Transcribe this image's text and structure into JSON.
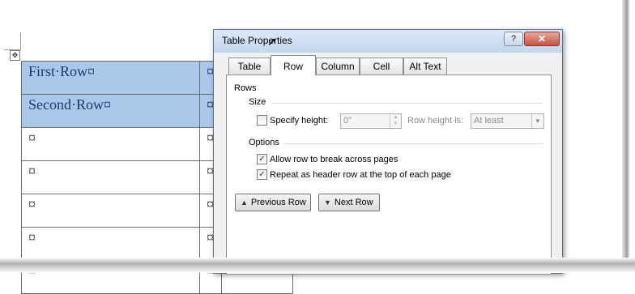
{
  "document": {
    "header_rows": [
      {
        "label": "First·Row¤",
        "end_mark": "¤",
        "last_mark": "¤"
      },
      {
        "label": "Second·Row¤",
        "end_mark": "¤",
        "last_mark": "¤"
      }
    ],
    "body_rows": [
      {
        "c1": "¤",
        "c2": "¤",
        "c3": "¤"
      },
      {
        "c1": "¤",
        "c2": "¤",
        "c3": "¤"
      },
      {
        "c1": "¤",
        "c2": "¤",
        "c3": "¤"
      },
      {
        "c1": "¤",
        "c2": "¤",
        "c3": "¤"
      },
      {
        "c1": "¤",
        "c2": "¤",
        "c3": "¤"
      }
    ],
    "move_handle_glyph": "✥",
    "header_fill": "#a9c8ea"
  },
  "dialog": {
    "title": "Table Properties",
    "help_glyph": "?",
    "close_glyph": "✕",
    "tabs": [
      "Table",
      "Row",
      "Column",
      "Cell",
      "Alt Text"
    ],
    "active_tab": "Row",
    "section_rows": "Rows",
    "size_label": "Size",
    "specify_height_label": "Specify height:",
    "specify_height_checked": false,
    "height_value": "0\"",
    "row_height_is_label": "Row height is:",
    "row_height_is_value": "At least",
    "options_label": "Options",
    "allow_break_label": "Allow row to break across pages",
    "allow_break_checked": true,
    "repeat_header_label": "Repeat as header row at the top of each page",
    "repeat_header_checked": true,
    "check_glyph": "✓",
    "previous_row_label": "Previous Row",
    "next_row_label": "Next Row"
  }
}
